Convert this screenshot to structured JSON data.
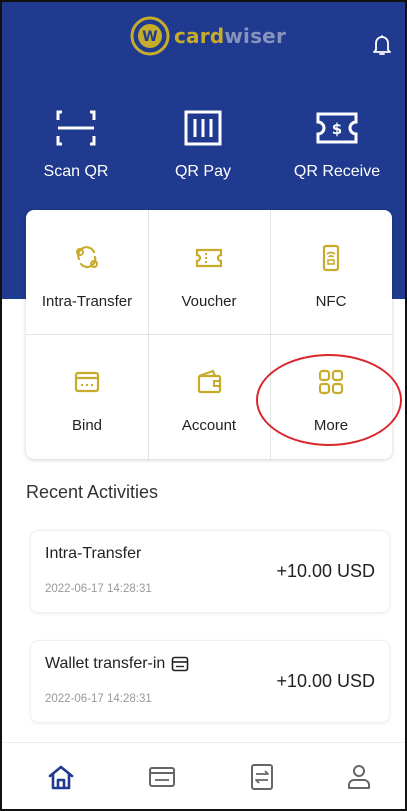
{
  "app": {
    "brand_part1": "card",
    "brand_part2": "wiser",
    "brand_icon": "cardwiser-logo-icon",
    "colors": {
      "header": "#1f3a8e",
      "accent": "#c7ac2c",
      "highlight": "#d9262c"
    }
  },
  "quick_actions": [
    {
      "label": "Scan QR",
      "icon": "scan-qr-icon"
    },
    {
      "label": "QR Pay",
      "icon": "qr-pay-icon"
    },
    {
      "label": "QR Receive",
      "icon": "qr-receive-icon"
    }
  ],
  "services": [
    {
      "label": "Intra-Transfer",
      "icon": "transfer-cycle-icon"
    },
    {
      "label": "Voucher",
      "icon": "voucher-icon"
    },
    {
      "label": "NFC",
      "icon": "nfc-phone-icon"
    },
    {
      "label": "Bind",
      "icon": "card-icon"
    },
    {
      "label": "Account",
      "icon": "wallet-icon"
    },
    {
      "label": "More",
      "icon": "grid-more-icon"
    }
  ],
  "recent": {
    "title": "Recent Activities",
    "items": [
      {
        "name": "Intra-Transfer",
        "time": "2022-06-17 14:28:31",
        "amount": "+10.00 USD"
      },
      {
        "name": "Wallet transfer-in",
        "time": "2022-06-17 14:28:31",
        "amount": "+10.00 USD",
        "icon": "card-icon"
      }
    ]
  },
  "bottom_nav": [
    {
      "icon": "home-icon",
      "active": true
    },
    {
      "icon": "card-icon",
      "active": false
    },
    {
      "icon": "transfer-icon",
      "active": false
    },
    {
      "icon": "profile-icon",
      "active": false
    }
  ]
}
